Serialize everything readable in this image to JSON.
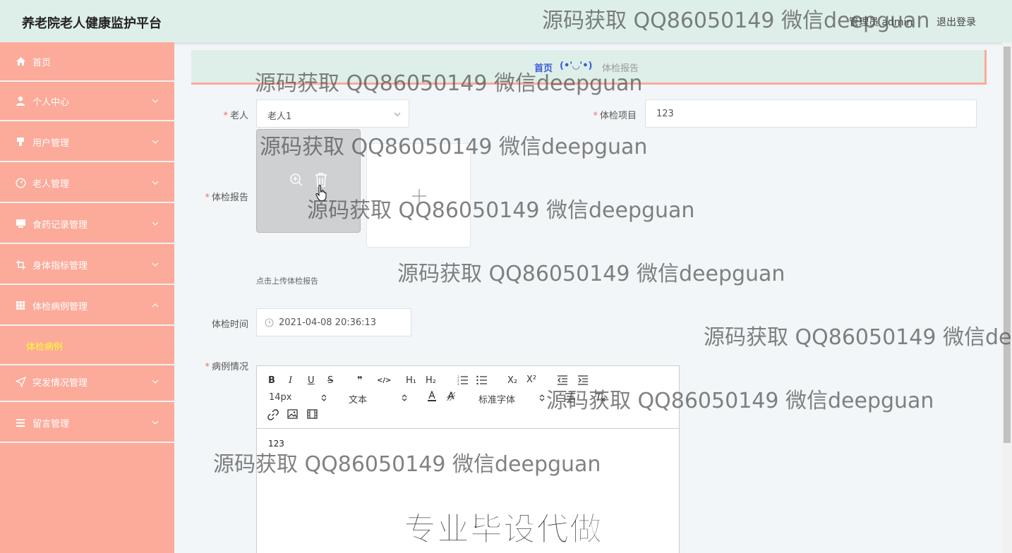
{
  "header": {
    "title": "养老院老人健康监护平台",
    "user_label": "管理员 admin",
    "logout_label": "退出登录"
  },
  "sidebar": {
    "items": [
      {
        "label": "首页",
        "icon": "home-icon"
      },
      {
        "label": "个人中心",
        "icon": "user-icon"
      },
      {
        "label": "用户管理",
        "icon": "users-icon"
      },
      {
        "label": "老人管理",
        "icon": "gauge-icon"
      },
      {
        "label": "食药记录管理",
        "icon": "monitor-icon"
      },
      {
        "label": "身体指标管理",
        "icon": "crop-icon"
      },
      {
        "label": "体检病例管理",
        "icon": "grid-icon"
      },
      {
        "label": "突发情况管理",
        "icon": "send-icon"
      },
      {
        "label": "留言管理",
        "icon": "list-icon"
      }
    ],
    "sub_item": "体检病例"
  },
  "breadcrumb": {
    "home": "首页",
    "separator": "(•'◡'•)",
    "current": "体检报告"
  },
  "form": {
    "elder": {
      "label": "老人",
      "value": "老人1"
    },
    "exam_item": {
      "label": "体检项目",
      "value": "123"
    },
    "exam_report": {
      "label": "体检报告",
      "upload_hint": "点击上传体检报告"
    },
    "exam_time": {
      "label": "体检时间",
      "value": "2021-04-08 20:36:13"
    },
    "case_info": {
      "label": "病例情况",
      "content": "123"
    }
  },
  "editor": {
    "font_size": "14px",
    "paragraph": "文本",
    "font_family": "标准字体",
    "buttons": {
      "bold": "B",
      "italic": "I",
      "underline": "U",
      "strike": "S",
      "quote": "❞",
      "code": "</>",
      "h1": "H₁",
      "h2": "H₂",
      "sub": "X₂",
      "sup": "X²"
    }
  },
  "watermarks": [
    "源码获取 QQ86050149 微信deepguan",
    "源码获取 QQ86050149 微信deepguan",
    "源码获取 QQ86050149 微信deepguan",
    "源码获取 QQ86050149 微信deepguan",
    "源码获取 QQ86050149 微信deepguan",
    "源码获取 QQ86050149 微信dee",
    "源码获取 QQ86050149 微信deepguan",
    "源码获取 QQ86050149 微信deepguan"
  ],
  "promo": "专业毕设代做",
  "colors": {
    "sidebar_bg": "#fcaa99",
    "header_bg": "#deefe9",
    "active_submenu": "#ffff33",
    "breadcrumb_link": "#3a5bd9",
    "required": "#f56c6c"
  }
}
